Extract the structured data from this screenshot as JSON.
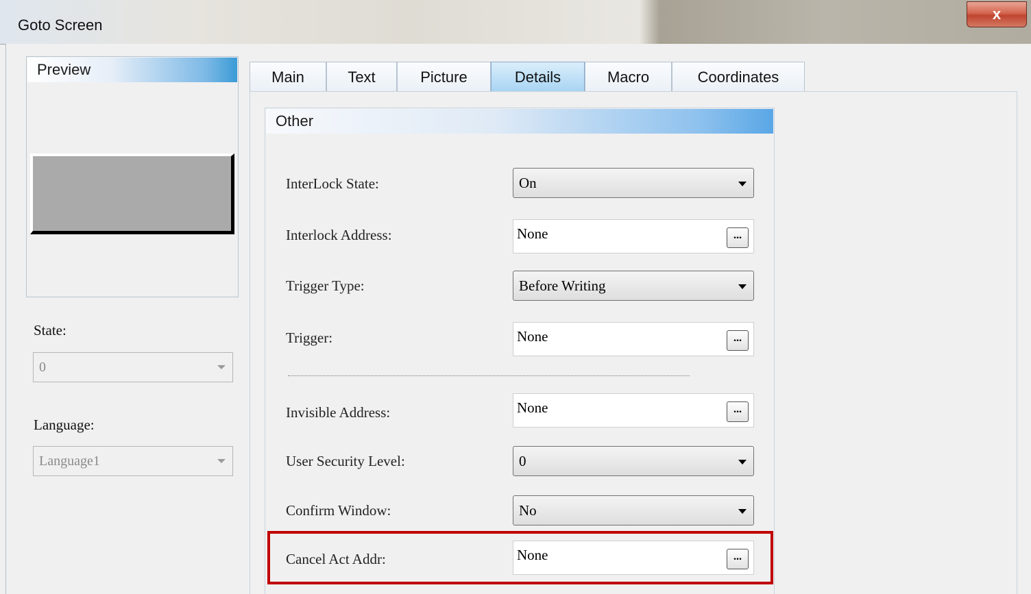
{
  "window": {
    "title": "Goto Screen",
    "close_glyph": "x",
    "close_icon": "close-icon"
  },
  "preview": {
    "header": "Preview",
    "state_label": "State:",
    "state_value": "0",
    "language_label": "Language:",
    "language_value": "Language1"
  },
  "tabs": [
    {
      "label": "Main",
      "active": false
    },
    {
      "label": "Text",
      "active": false
    },
    {
      "label": "Picture",
      "active": false
    },
    {
      "label": "Details",
      "active": true
    },
    {
      "label": "Macro",
      "active": false
    },
    {
      "label": "Coordinates",
      "active": false
    }
  ],
  "other": {
    "header": "Other",
    "fields": {
      "interlock_state": {
        "label": "InterLock State:",
        "value": "On"
      },
      "interlock_address": {
        "label": "Interlock Address:",
        "value": "None"
      },
      "trigger_type": {
        "label": "Trigger Type:",
        "value": "Before Writing"
      },
      "trigger": {
        "label": "Trigger:",
        "value": "None"
      },
      "invisible_address": {
        "label": "Invisible Address:",
        "value": "None"
      },
      "user_security_level": {
        "label": "User Security Level:",
        "value": "0"
      },
      "confirm_window": {
        "label": "Confirm Window:",
        "value": "No"
      },
      "cancel_act_addr": {
        "label": "Cancel Act Addr:",
        "value": "None"
      }
    },
    "browse_label": "..."
  },
  "colors": {
    "highlight": "#c00000",
    "active_tab": "#a7d4f3"
  }
}
